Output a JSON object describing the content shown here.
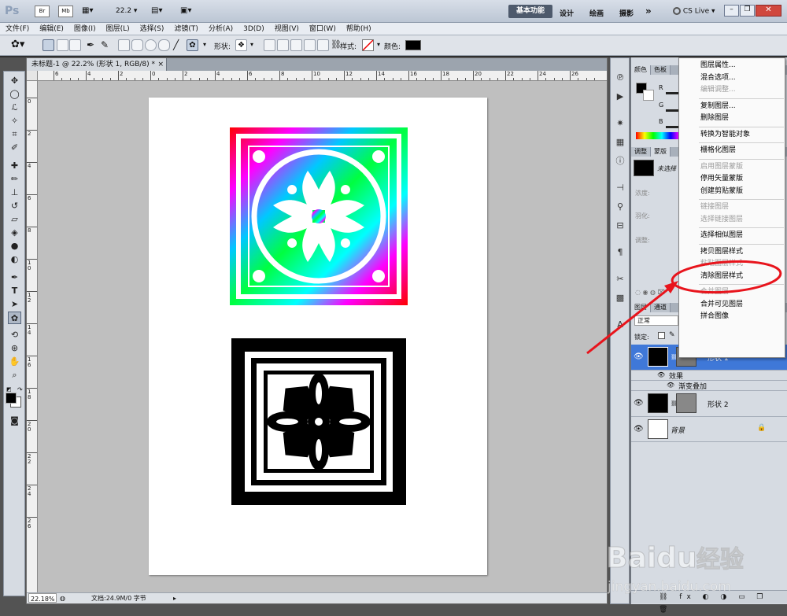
{
  "app": {
    "logo": "Ps",
    "zoom_select": "22.2",
    "workspace_active": "基本功能",
    "workspaces": [
      "设计",
      "绘画",
      "摄影"
    ],
    "more": "»",
    "cslive": "CS Live",
    "cslive_arrow": "▾"
  },
  "menu": [
    "文件(F)",
    "编辑(E)",
    "图像(I)",
    "图层(L)",
    "选择(S)",
    "滤镜(T)",
    "分析(A)",
    "3D(D)",
    "视图(V)",
    "窗口(W)",
    "帮助(H)"
  ],
  "options": {
    "shape_label": "形状:",
    "style_label": "样式:",
    "color_label": "颜色:",
    "color_value": "#000000"
  },
  "document": {
    "tab_title": "未标题-1 @ 22.2% (形状 1, RGB/8) *",
    "close": "×",
    "zoom": "22.18%",
    "doc_info": "文档:24.9M/0 字节",
    "ruler_labels": [
      "6",
      "4",
      "2",
      "0",
      "2",
      "4",
      "6",
      "8",
      "10",
      "12",
      "14",
      "16",
      "18",
      "20",
      "22",
      "24",
      "26"
    ],
    "ruler_left_labels": [
      "0",
      "2",
      "4",
      "6",
      "8",
      "1\n0",
      "1\n2",
      "1\n4",
      "1\n6",
      "1\n8",
      "2\n0",
      "2\n2",
      "2\n4",
      "2\n6"
    ]
  },
  "panels": {
    "color_tabs": [
      "颜色",
      "色板"
    ],
    "adjust_tabs": [
      "调整",
      "蒙版"
    ],
    "layers_tabs": [
      "图层",
      "通道"
    ],
    "rgb": [
      "R",
      "G",
      "B"
    ],
    "mask_label": "未选择",
    "density": "浓度:",
    "feather": "羽化:",
    "adjust": "调整:",
    "blend_mode": "正常",
    "lock_label": "锁定:"
  },
  "layers": [
    {
      "name": "形状 1",
      "selected": true,
      "fx": "fx"
    },
    {
      "name": "效果",
      "sub": true
    },
    {
      "name": "渐变叠加",
      "sub": true
    },
    {
      "name": "形状 2",
      "selected": false
    },
    {
      "name": "背景",
      "selected": false,
      "locked": true
    }
  ],
  "context_menu": [
    {
      "label": "图层属性...",
      "enabled": true
    },
    {
      "label": "混合选项...",
      "enabled": true
    },
    {
      "label": "编辑调整...",
      "enabled": false
    },
    {
      "sep": true
    },
    {
      "label": "复制图层...",
      "enabled": true
    },
    {
      "label": "删除图层",
      "enabled": true
    },
    {
      "sep": true
    },
    {
      "label": "转换为智能对象",
      "enabled": true
    },
    {
      "sep": true
    },
    {
      "label": "栅格化图层",
      "enabled": true
    },
    {
      "sep": true
    },
    {
      "label": "启用图层蒙版",
      "enabled": false
    },
    {
      "label": "停用矢量蒙版",
      "enabled": true
    },
    {
      "label": "创建剪贴蒙版",
      "enabled": true
    },
    {
      "sep": true
    },
    {
      "label": "链接图层",
      "enabled": false
    },
    {
      "label": "选择链接图层",
      "enabled": false
    },
    {
      "sep": true
    },
    {
      "label": "选择相似图层",
      "enabled": true
    },
    {
      "sep": true
    },
    {
      "label": "拷贝图层样式",
      "enabled": true,
      "highlighted": true
    },
    {
      "label": "粘贴图层样式",
      "enabled": false
    },
    {
      "label": "清除图层样式",
      "enabled": true
    },
    {
      "sep": true
    },
    {
      "label": "合并图层",
      "enabled": false
    },
    {
      "label": "合并可见图层",
      "enabled": true
    },
    {
      "label": "拼合图像",
      "enabled": true
    }
  ],
  "watermark": {
    "brand": "Baidu",
    "cn": "经验",
    "url": "jingyan.baidu.com"
  },
  "annotation_color": "#e8141c"
}
